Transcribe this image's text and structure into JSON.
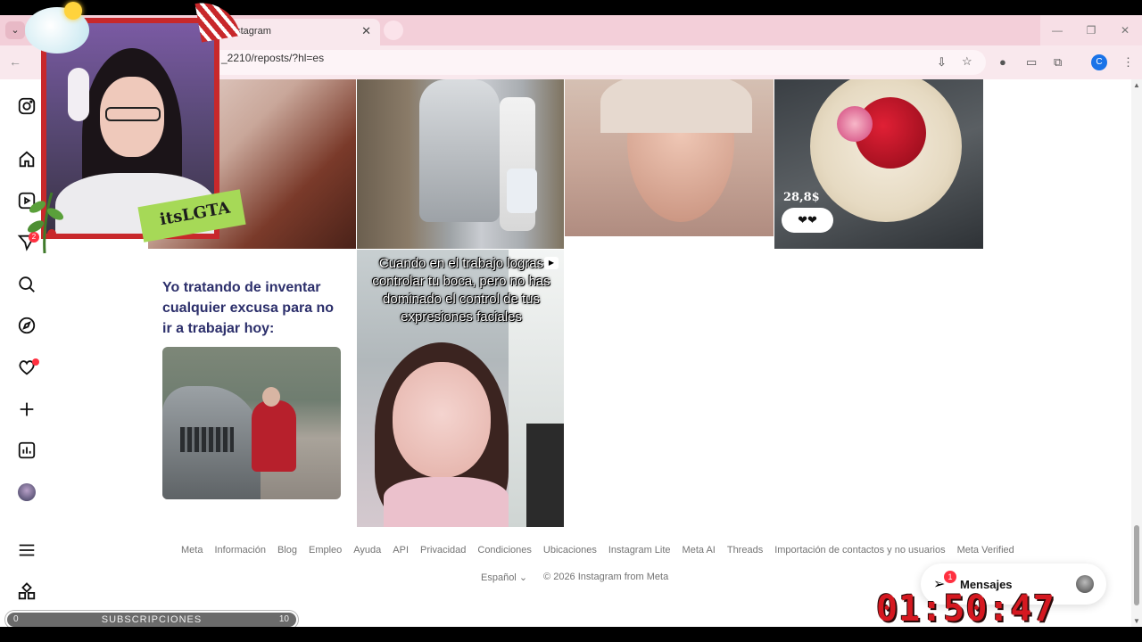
{
  "browser": {
    "tab_title": "nstagram",
    "url": "_2210/reposts/?hl=es",
    "profile_initial": "C",
    "window_controls": [
      "—",
      "❐",
      "✕"
    ]
  },
  "overlay": {
    "streamer_name": "itsLGTA",
    "subscriptions_label": "SUBSCRIPCIONES",
    "subscriptions_min": "0",
    "subscriptions_max": "10",
    "clock": "01:50:47"
  },
  "sidebar": {
    "items": [
      {
        "name": "instagram-logo-icon"
      },
      {
        "name": "home-icon"
      },
      {
        "name": "reels-icon"
      },
      {
        "name": "messages-icon",
        "badge": "2"
      },
      {
        "name": "search-icon"
      },
      {
        "name": "explore-icon"
      },
      {
        "name": "notifications-icon"
      },
      {
        "name": "create-icon"
      },
      {
        "name": "dashboard-icon"
      },
      {
        "name": "profile-avatar"
      },
      {
        "name": "menu-icon"
      },
      {
        "name": "also-from-meta-icon"
      }
    ]
  },
  "posts": {
    "flowers_price": "28,8$",
    "meme_text": "Yo tratando de inventar cualquier excusa para no ir a trabajar hoy:",
    "kid_caption": "Cuando en el trabajo logras controlar tu boca, pero no has dominado el control de tus expresiones faciales"
  },
  "footer": {
    "links": [
      "Meta",
      "Información",
      "Blog",
      "Empleo",
      "Ayuda",
      "API",
      "Privacidad",
      "Condiciones",
      "Ubicaciones",
      "Instagram Lite",
      "Meta AI",
      "Threads",
      "Importación de contactos y no usuarios",
      "Meta Verified"
    ],
    "language": "Español",
    "copyright": "© 2026 Instagram from Meta"
  },
  "messages": {
    "label": "Mensajes",
    "badge": "1"
  }
}
